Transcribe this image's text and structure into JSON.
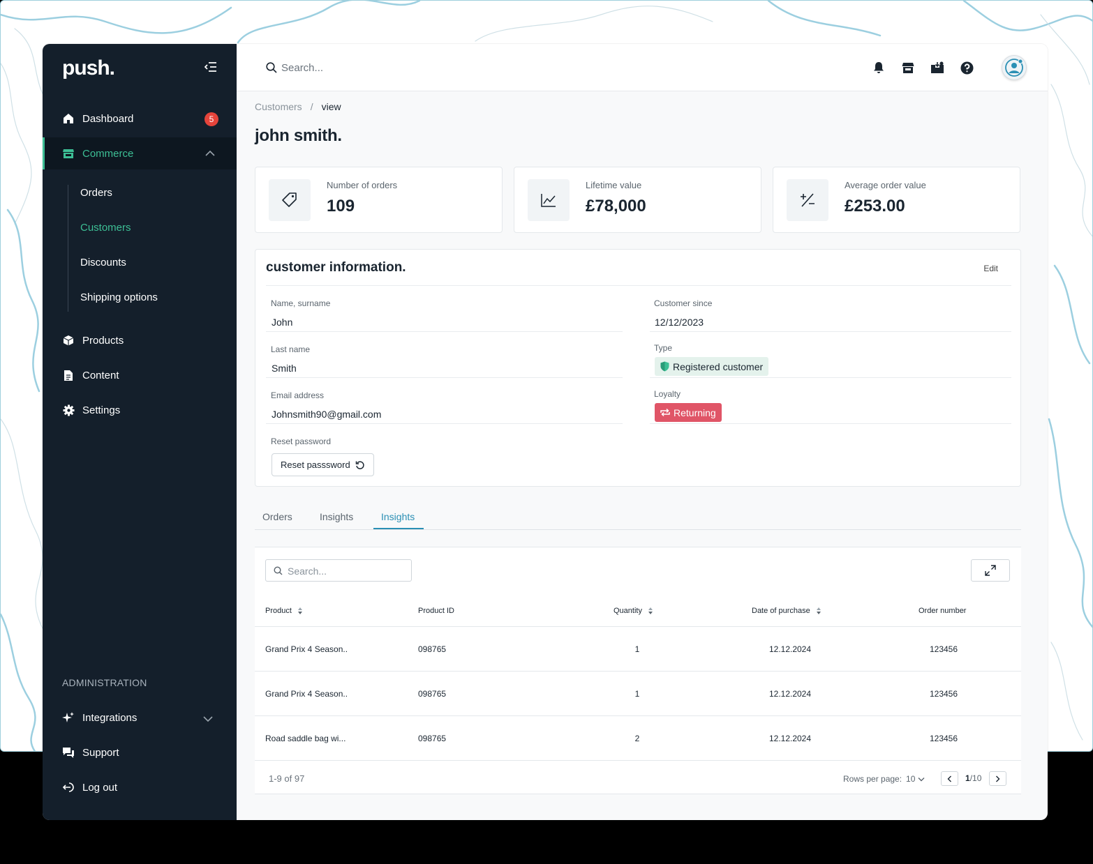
{
  "app": {
    "logo": "push."
  },
  "sidebar": {
    "items": [
      {
        "label": "Dashboard",
        "icon": "home-icon",
        "badge": "5"
      },
      {
        "label": "Commerce",
        "icon": "store-icon"
      },
      {
        "label": "Products",
        "icon": "box-icon"
      },
      {
        "label": "Content",
        "icon": "document-icon"
      },
      {
        "label": "Settings",
        "icon": "gear-icon"
      }
    ],
    "commerce_sub": [
      "Orders",
      "Customers",
      "Discounts",
      "Shipping options"
    ],
    "active_sub": "Customers",
    "admin_label": "ADMINISTRATION",
    "admin_items": [
      {
        "label": "Integrations",
        "icon": "sparkle-icon"
      },
      {
        "label": "Support",
        "icon": "chat-icon"
      },
      {
        "label": "Log out",
        "icon": "logout-icon"
      }
    ]
  },
  "topbar": {
    "search_placeholder": "Search...",
    "icons": [
      "bell-icon",
      "store-icon",
      "inbox-icon",
      "help-icon",
      "user-avatar-icon"
    ]
  },
  "breadcrumb": {
    "parent": "Customers",
    "sep": "/",
    "current": "view"
  },
  "page": {
    "title": "john smith."
  },
  "stats": [
    {
      "label": "Number of orders",
      "value": "109",
      "icon": "tag-icon"
    },
    {
      "label": "Lifetime value",
      "value": "£78,000",
      "icon": "line-chart-icon"
    },
    {
      "label": "Average order value",
      "value": "£253.00",
      "icon": "plus-minus-icon"
    }
  ],
  "customer": {
    "title": "customer information.",
    "edit_label": "Edit",
    "name_label": "Name, surname",
    "name": "John",
    "last_label": "Last name",
    "last": "Smith",
    "email_label": "Email address",
    "email": "Johnsmith90@gmail.com",
    "reset_label": "Reset password",
    "reset_button": "Reset passsword",
    "since_label": "Customer since",
    "since": "12/12/2023",
    "type_label": "Type",
    "type": "Registered customer",
    "loyalty_label": "Loyalty",
    "loyalty": "Returning"
  },
  "tabs": [
    {
      "label": "Orders"
    },
    {
      "label": "Insights"
    },
    {
      "label": "Insights"
    }
  ],
  "active_tab": 2,
  "table": {
    "search_placeholder": "Search...",
    "columns": [
      "Product",
      "Product ID",
      "Quantity",
      "Date of purchase",
      "Order number"
    ],
    "rows": [
      [
        "Grand Prix 4 Season..",
        "098765",
        "1",
        "12.12.2024",
        "123456"
      ],
      [
        "Grand Prix 4 Season..",
        "098765",
        "1",
        "12.12.2024",
        "123456"
      ],
      [
        "Road saddle bag wi...",
        "098765",
        "2",
        "12.12.2024",
        "123456"
      ]
    ],
    "count": "1-9 of 97",
    "rows_per_page_label": "Rows per page:",
    "rows_per_page": "10",
    "page_current": "1",
    "page_total": "/10"
  },
  "colors": {
    "accent_green": "#3dbf95",
    "accent_blue": "#2a8fb4",
    "sidebar_bg": "#141f2b",
    "badge_red": "#e5443b",
    "loyalty_red": "#e05567"
  }
}
